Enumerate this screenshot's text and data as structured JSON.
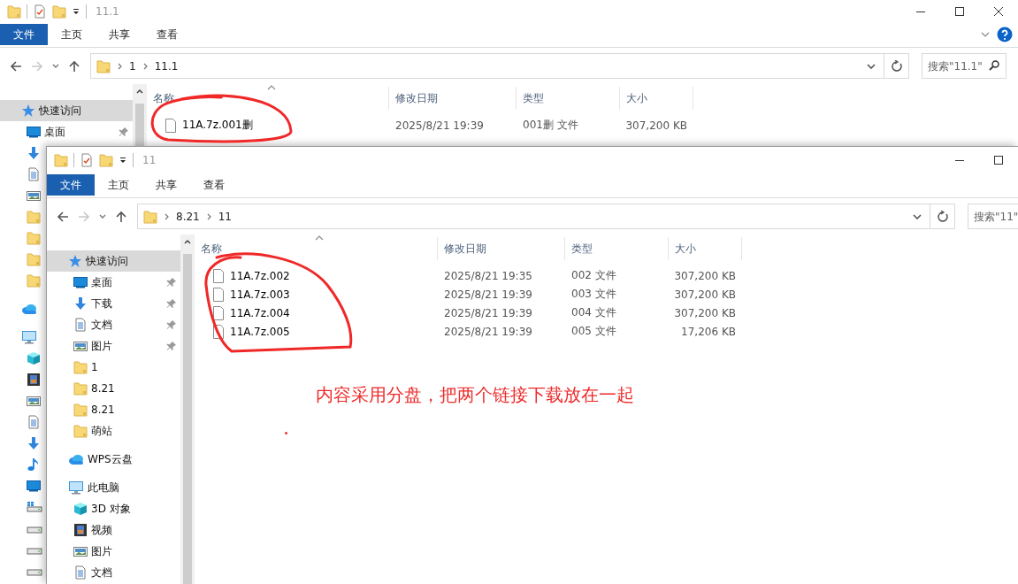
{
  "windows": [
    {
      "title": "11.1",
      "ribbon_tabs": [
        {
          "label": "文件",
          "selected": true
        },
        {
          "label": "主页",
          "selected": false
        },
        {
          "label": "共享",
          "selected": false
        },
        {
          "label": "查看",
          "selected": false
        }
      ],
      "breadcrumb": [
        "1",
        "11.1"
      ],
      "search": {
        "placeholder": "搜索\"11.1\""
      },
      "navigation": [
        {
          "label": "快速访问",
          "kind": "quick-access",
          "selected": true,
          "children": [
            {
              "label": "桌面",
              "kind": "desktop",
              "pinned": true,
              "selected": false
            },
            {
              "kind": "downloads",
              "selected": false
            },
            {
              "kind": "documents",
              "selected": false
            },
            {
              "kind": "pictures",
              "selected": false
            },
            {
              "kind": "folder",
              "selected": false
            },
            {
              "kind": "folder",
              "selected": false
            },
            {
              "kind": "folder",
              "selected": false
            },
            {
              "kind": "folder",
              "selected": false
            }
          ]
        },
        {
          "kind": "cloud",
          "selected": false
        },
        {
          "kind": "computer",
          "selected": false,
          "children": [
            {
              "kind": "cube",
              "selected": false
            },
            {
              "kind": "videos",
              "selected": false
            },
            {
              "kind": "pictures",
              "selected": false
            },
            {
              "kind": "documents",
              "selected": false
            },
            {
              "kind": "downloads",
              "selected": false
            },
            {
              "kind": "music",
              "selected": false
            },
            {
              "kind": "desktop",
              "selected": false
            },
            {
              "kind": "sysdrive",
              "selected": false
            },
            {
              "kind": "drive",
              "selected": false
            },
            {
              "kind": "drive",
              "selected": false
            },
            {
              "kind": "drive",
              "selected": false
            }
          ]
        }
      ],
      "columns": [
        "名称",
        "修改日期",
        "类型",
        "大小"
      ],
      "files": [
        {
          "name": "11A.7z.001删",
          "modified": "2025/8/21 19:39",
          "type": "001删 文件",
          "size": "307,200 KB",
          "selected": false
        }
      ]
    },
    {
      "title": "11",
      "ribbon_tabs": [
        {
          "label": "文件",
          "selected": true
        },
        {
          "label": "主页",
          "selected": false
        },
        {
          "label": "共享",
          "selected": false
        },
        {
          "label": "查看",
          "selected": false
        }
      ],
      "breadcrumb": [
        "8.21",
        "11"
      ],
      "search": {
        "placeholder": "搜索\"11\""
      },
      "navigation": [
        {
          "label": "快速访问",
          "kind": "quick-access",
          "selected": true,
          "children": [
            {
              "label": "桌面",
              "kind": "desktop",
              "pinned": true,
              "selected": false
            },
            {
              "label": "下载",
              "kind": "downloads",
              "pinned": true,
              "selected": false
            },
            {
              "label": "文档",
              "kind": "documents",
              "pinned": true,
              "selected": false
            },
            {
              "label": "图片",
              "kind": "pictures",
              "pinned": true,
              "selected": false
            },
            {
              "label": "1",
              "kind": "folder",
              "pinned": false,
              "selected": false
            },
            {
              "label": "8.21",
              "kind": "folder",
              "pinned": false,
              "selected": false
            },
            {
              "label": "8.21",
              "kind": "folder",
              "pinned": false,
              "selected": false
            },
            {
              "label": "萌站",
              "kind": "folder",
              "pinned": false,
              "selected": false
            }
          ]
        },
        {
          "label": "WPS云盘",
          "kind": "cloud",
          "selected": false
        },
        {
          "label": "此电脑",
          "kind": "computer",
          "selected": false,
          "children": [
            {
              "label": "3D 对象",
              "kind": "cube",
              "selected": false
            },
            {
              "label": "视频",
              "kind": "videos",
              "selected": false
            },
            {
              "label": "图片",
              "kind": "pictures",
              "selected": false
            },
            {
              "label": "文档",
              "kind": "documents",
              "selected": false
            }
          ]
        }
      ],
      "columns": [
        "名称",
        "修改日期",
        "类型",
        "大小"
      ],
      "files": [
        {
          "name": "11A.7z.002",
          "modified": "2025/8/21 19:35",
          "type": "002 文件",
          "size": "307,200 KB",
          "selected": false
        },
        {
          "name": "11A.7z.003",
          "modified": "2025/8/21 19:39",
          "type": "003 文件",
          "size": "307,200 KB",
          "selected": false
        },
        {
          "name": "11A.7z.004",
          "modified": "2025/8/21 19:39",
          "type": "004 文件",
          "size": "307,200 KB",
          "selected": false
        },
        {
          "name": "11A.7z.005",
          "modified": "2025/8/21 19:39",
          "type": "005 文件",
          "size": "17,206 KB",
          "selected": false
        }
      ]
    }
  ],
  "annotation": {
    "note": "内容采用分盘，把两个链接下载放在一起"
  }
}
